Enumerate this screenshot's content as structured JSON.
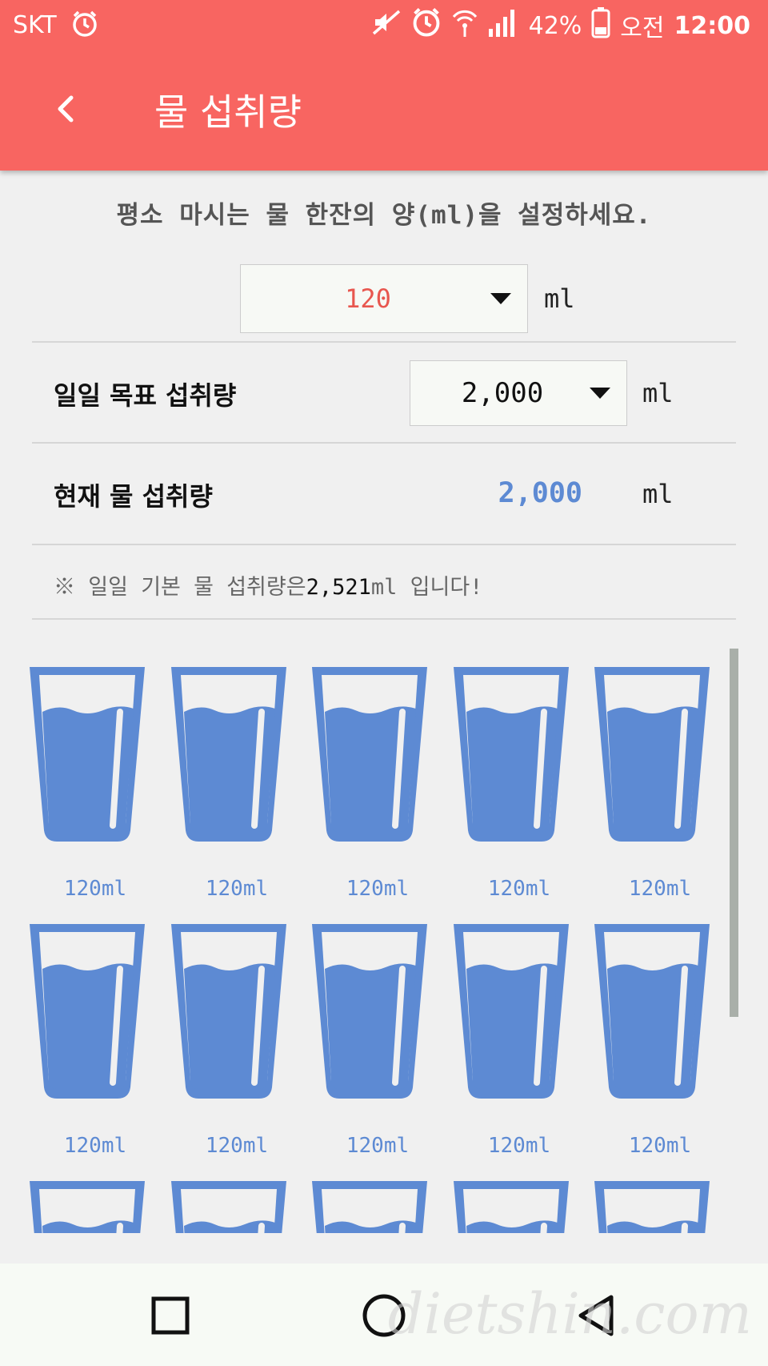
{
  "status_bar": {
    "carrier": "SKT",
    "battery_percent": "42%",
    "time_prefix": "오전",
    "time": "12:00"
  },
  "header": {
    "title": "물 섭취량"
  },
  "cup_setting": {
    "prompt": "평소 마시는 물 한잔의 양(ml)을 설정하세요.",
    "selected_value": "120",
    "unit": "ml"
  },
  "daily_goal": {
    "label": "일일 목표 섭취량",
    "selected_value": "2,000",
    "unit": "ml"
  },
  "current_intake": {
    "label": "현재 물 섭취량",
    "value": "2,000",
    "unit": "ml"
  },
  "note": {
    "prefix": "※ 일일 기본 물 섭취량은",
    "amount": "2,521",
    "suffix": "ml 입니다!"
  },
  "cups": [
    {
      "label": "120ml"
    },
    {
      "label": "120ml"
    },
    {
      "label": "120ml"
    },
    {
      "label": "120ml"
    },
    {
      "label": "120ml"
    },
    {
      "label": "120ml"
    },
    {
      "label": "120ml"
    },
    {
      "label": "120ml"
    },
    {
      "label": "120ml"
    },
    {
      "label": "120ml"
    },
    {
      "label": ""
    },
    {
      "label": ""
    },
    {
      "label": ""
    },
    {
      "label": ""
    },
    {
      "label": ""
    }
  ],
  "colors": {
    "header": "#f86561",
    "cup": "#5d8ad3",
    "selected_value": "#e8574f"
  },
  "watermark": "dietshin.com"
}
